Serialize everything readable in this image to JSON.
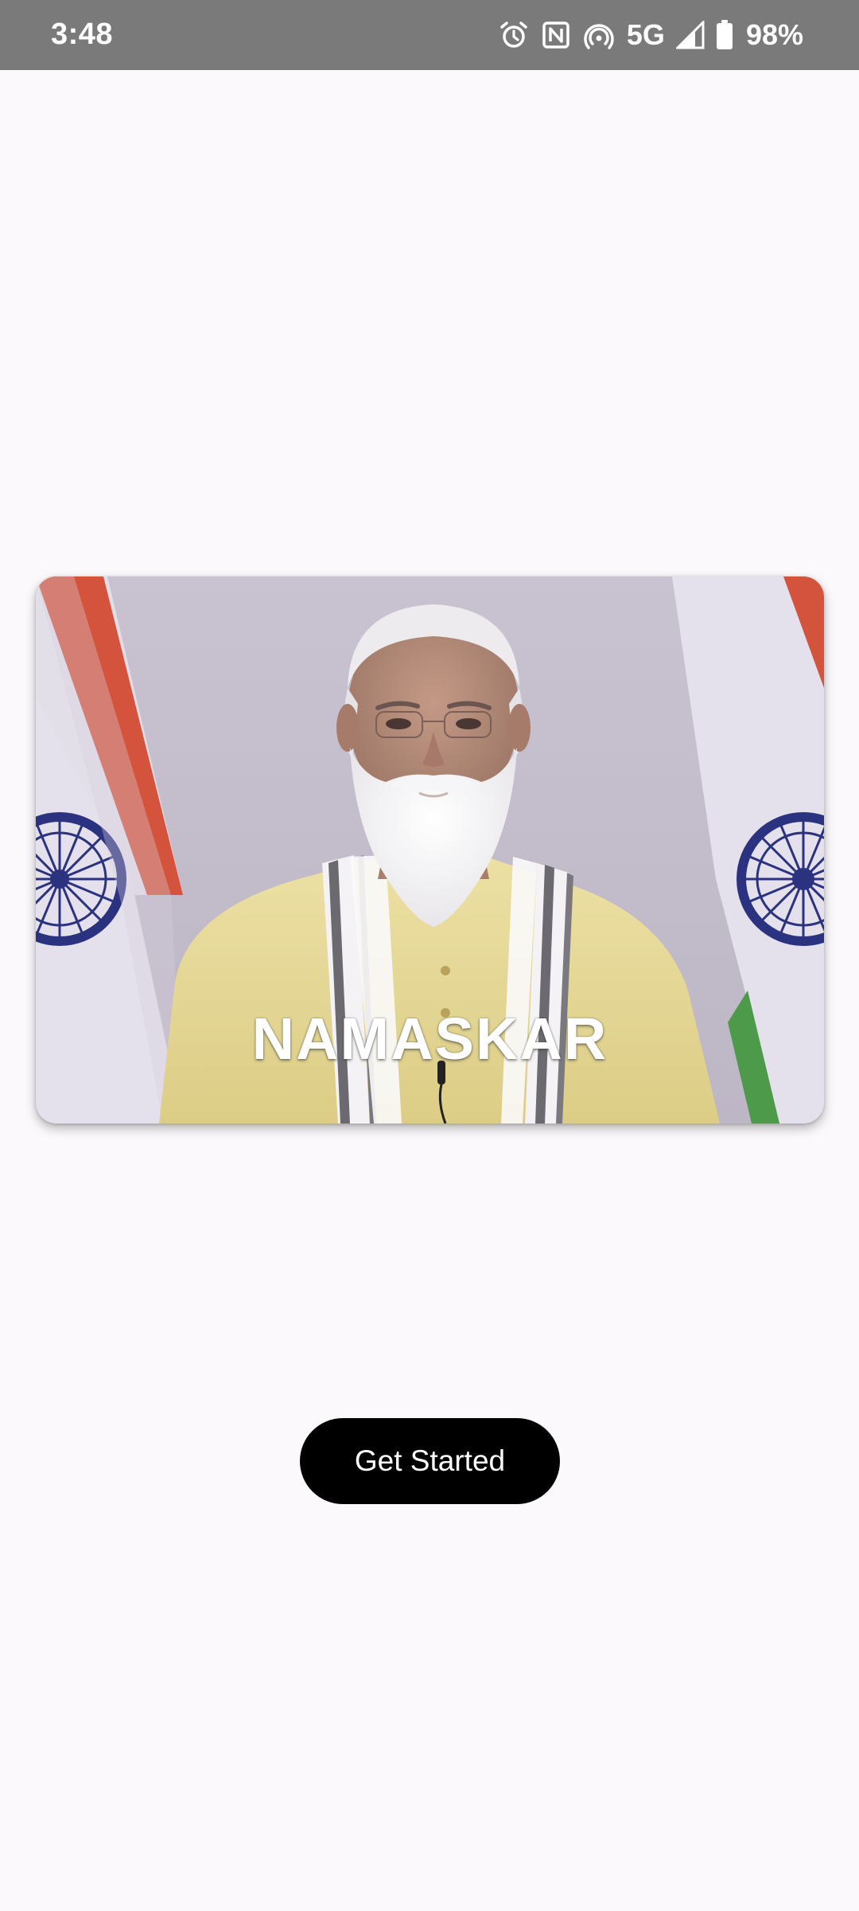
{
  "status_bar": {
    "time": "3:48",
    "network": "5G",
    "battery": "98%",
    "icons": [
      "alarm-icon",
      "nfc-icon",
      "hotspot-icon",
      "signal-icon",
      "battery-icon"
    ]
  },
  "media": {
    "caption": "NAMASKAR",
    "colors": {
      "flag_saffron": "#d3533c",
      "flag_white": "#e4e1ec",
      "flag_green": "#4c9a4a",
      "chakra_navy": "#2b3380",
      "backdrop": "#c5bfcc",
      "kurta": "#e6d898"
    }
  },
  "actions": {
    "get_started": "Get Started"
  },
  "theme": {
    "background": "#fcf9fc",
    "status_bar": "#7a7a7a",
    "button_bg": "#000000",
    "button_text": "#ffffff"
  }
}
